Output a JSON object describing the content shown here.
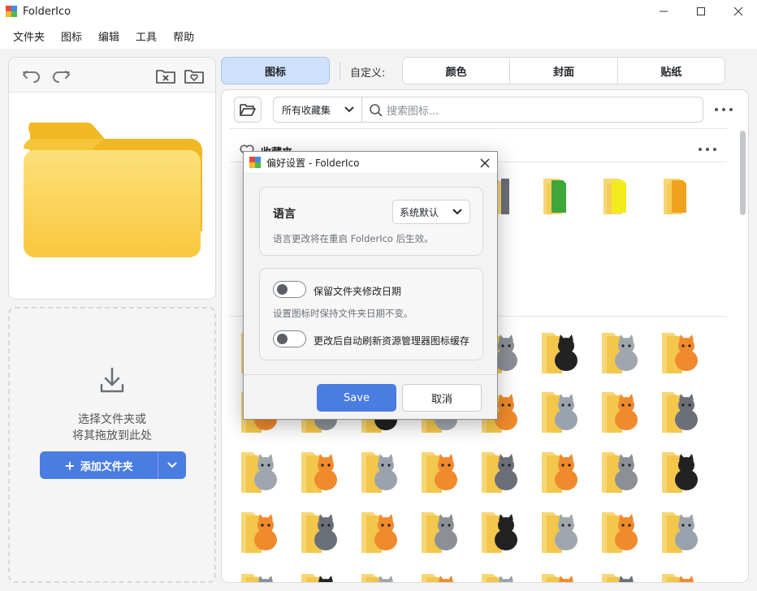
{
  "window": {
    "title": "FolderIco",
    "controls": [
      "minimize",
      "maximize",
      "close"
    ]
  },
  "menu": [
    "文件夹",
    "图标",
    "编辑",
    "工具",
    "帮助"
  ],
  "left_panel": {
    "toolbar_icons": [
      "undo-icon",
      "redo-icon",
      "remove-folder-icon",
      "favorite-folder-icon"
    ],
    "drop_text_line1": "选择文件夹或",
    "drop_text_line2": "将其拖放到此处",
    "add_button": "添加文件夹"
  },
  "tabs": {
    "icons": "图标",
    "custom_label": "自定义:",
    "custom_options": [
      "颜色",
      "封面",
      "贴纸"
    ]
  },
  "toolbar": {
    "collection": "所有收藏集",
    "search_placeholder": "搜索图标..."
  },
  "sections": {
    "favorites": "收藏夹"
  },
  "favorite_colors": [
    "#6b6f77",
    "#3ea63a",
    "#f3ec1c",
    "#f0a21f"
  ],
  "dialog": {
    "title": "偏好设置 - FolderIco",
    "language_label": "语言",
    "language_value": "系统默认",
    "language_hint": "语言更改将在重启 FolderIco 后生效。",
    "option1_label": "保留文件夹修改日期",
    "option1_enabled": false,
    "option1_hint": "设置图标时保持文件夹日期不变。",
    "option2_label": "更改后自动刷新资源管理器图标缓存",
    "option2_enabled": false,
    "save": "Save",
    "cancel": "取消"
  },
  "colors": {
    "accent": "#4a7de1",
    "tab_active_bg": "#cfe0fb",
    "folder_yellow": "#fbd35d"
  }
}
